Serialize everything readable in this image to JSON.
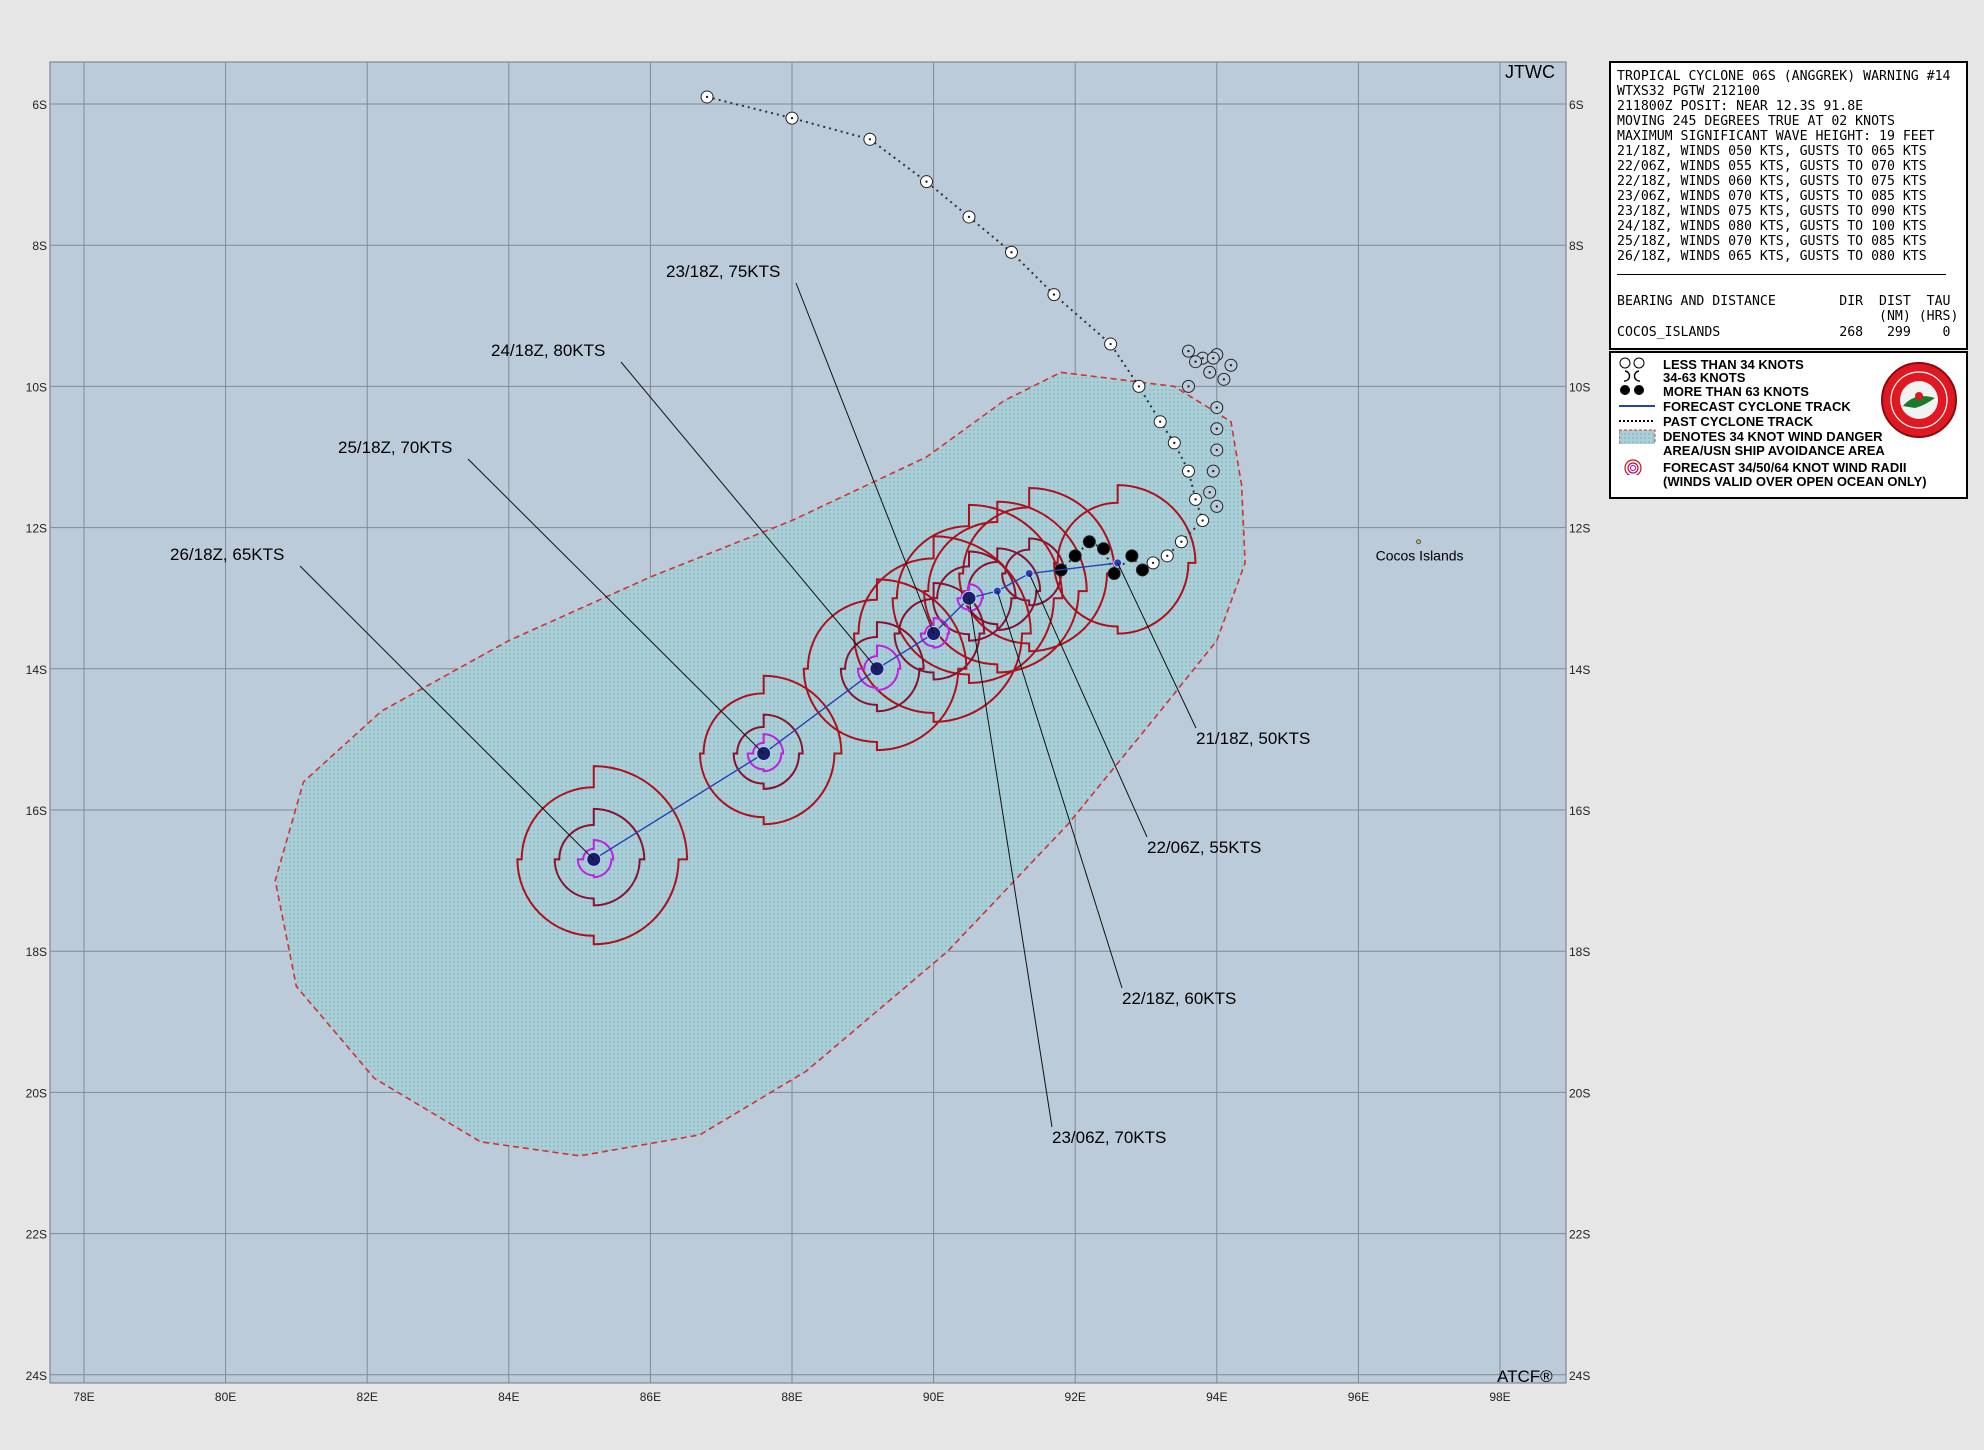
{
  "header": {
    "agency": "JTWC",
    "footer_mark": "ATCF®"
  },
  "info_panel": {
    "lines": [
      "TROPICAL CYCLONE 06S (ANGGREK) WARNING #14",
      "WTXS32 PGTW 212100",
      "211800Z POSIT: NEAR 12.3S 91.8E",
      "MOVING 245 DEGREES TRUE AT 02 KNOTS",
      "MAXIMUM SIGNIFICANT WAVE HEIGHT: 19 FEET",
      "21/18Z, WINDS 050 KTS, GUSTS TO 065 KTS",
      "22/06Z, WINDS 055 KTS, GUSTS TO 070 KTS",
      "22/18Z, WINDS 060 KTS, GUSTS TO 075 KTS",
      "23/06Z, WINDS 070 KTS, GUSTS TO 085 KTS",
      "23/18Z, WINDS 075 KTS, GUSTS TO 090 KTS",
      "24/18Z, WINDS 080 KTS, GUSTS TO 100 KTS",
      "25/18Z, WINDS 070 KTS, GUSTS TO 085 KTS",
      "26/18Z, WINDS 065 KTS, GUSTS TO 080 KTS"
    ],
    "bearing_header": "BEARING AND DISTANCE        DIR  DIST  TAU",
    "bearing_units": "                                 (NM) (HRS)",
    "bearing_row": "COCOS_ISLANDS               268   299    0"
  },
  "legend": {
    "items": [
      {
        "icon": "open-circle-icon",
        "label": "LESS THAN 34 KNOTS"
      },
      {
        "icon": "tropical-storm-icon",
        "label": "34-63 KNOTS"
      },
      {
        "icon": "hurricane-icon",
        "label": "MORE THAN 63 KNOTS"
      },
      {
        "icon": "forecast-track-icon",
        "label": "FORECAST CYCLONE TRACK"
      },
      {
        "icon": "past-track-icon",
        "label": "PAST CYCLONE TRACK"
      },
      {
        "icon": "danger-area-icon",
        "label": "DENOTES 34 KNOT WIND DANGER"
      },
      {
        "icon": "",
        "label": "AREA/USN SHIP AVOIDANCE AREA"
      },
      {
        "icon": "wind-radii-icon",
        "label": "FORECAST 34/50/64 KNOT WIND RADII"
      },
      {
        "icon": "",
        "label": "(WINDS VALID OVER OPEN OCEAN ONLY)"
      }
    ]
  },
  "map": {
    "lon_ticks": [
      "78E",
      "80E",
      "82E",
      "84E",
      "86E",
      "88E",
      "90E",
      "92E",
      "94E",
      "96E",
      "98E"
    ],
    "lat_ticks": [
      "6S",
      "8S",
      "10S",
      "12S",
      "14S",
      "16S",
      "18S",
      "20S",
      "22S",
      "24S"
    ],
    "place": {
      "name": "Cocos Islands",
      "lat": -12.2,
      "lon": 96.85
    },
    "colors": {
      "ocean": "#bccbda",
      "danger_fill": "#a9d0d8",
      "danger_edge": "#d23232",
      "radii_34": "#b0101c",
      "radii_50": "#8c1030",
      "radii_64": "#c020e0",
      "track": "#2a3fb3",
      "grid": "#808a94"
    },
    "forecast_points": [
      {
        "label": "21/18Z, 50KTS",
        "lat": -12.5,
        "lon": 92.6,
        "r34": 1.0,
        "r50": 0.0,
        "r64": 0.0
      },
      {
        "label": "22/06Z, 55KTS",
        "lat": -12.65,
        "lon": 91.35,
        "r34": 1.1,
        "r50": 0.45,
        "r64": 0.0
      },
      {
        "label": "22/18Z, 60KTS",
        "lat": -12.9,
        "lon": 90.9,
        "r34": 1.15,
        "r50": 0.55,
        "r64": 0.0
      },
      {
        "label": "23/06Z, 70KTS",
        "lat": -13.0,
        "lon": 90.5,
        "r34": 1.2,
        "r50": 0.6,
        "r64": 0.18
      },
      {
        "label": "23/18Z, 75KTS",
        "lat": -13.5,
        "lon": 90.0,
        "r34": 1.25,
        "r50": 0.65,
        "r64": 0.2
      },
      {
        "label": "24/18Z, 80KTS",
        "lat": -14.0,
        "lon": 89.2,
        "r34": 1.15,
        "r50": 0.6,
        "r64": 0.3
      },
      {
        "label": "25/18Z, 70KTS",
        "lat": -15.2,
        "lon": 87.6,
        "r34": 1.0,
        "r50": 0.5,
        "r64": 0.25
      },
      {
        "label": "26/18Z, 65KTS",
        "lat": -16.7,
        "lon": 85.2,
        "r34": 1.2,
        "r50": 0.65,
        "r64": 0.25
      }
    ],
    "past_track": [
      {
        "lat": -5.9,
        "lon": 86.8
      },
      {
        "lat": -6.2,
        "lon": 88.0
      },
      {
        "lat": -6.5,
        "lon": 89.1
      },
      {
        "lat": -7.1,
        "lon": 89.9
      },
      {
        "lat": -7.6,
        "lon": 90.5
      },
      {
        "lat": -8.1,
        "lon": 91.1
      },
      {
        "lat": -8.7,
        "lon": 91.7
      },
      {
        "lat": -9.4,
        "lon": 92.5
      },
      {
        "lat": -10.0,
        "lon": 92.9
      },
      {
        "lat": -10.5,
        "lon": 93.2
      },
      {
        "lat": -10.8,
        "lon": 93.4
      },
      {
        "lat": -11.2,
        "lon": 93.6
      },
      {
        "lat": -11.6,
        "lon": 93.7
      },
      {
        "lat": -11.9,
        "lon": 93.8
      },
      {
        "lat": -12.2,
        "lon": 93.5
      },
      {
        "lat": -12.4,
        "lon": 93.3
      },
      {
        "lat": -12.5,
        "lon": 93.1
      },
      {
        "lat": -12.6,
        "lon": 92.95
      },
      {
        "lat": -12.4,
        "lon": 92.8
      },
      {
        "lat": -12.65,
        "lon": 92.55
      },
      {
        "lat": -12.3,
        "lon": 92.4
      },
      {
        "lat": -12.2,
        "lon": 92.2
      },
      {
        "lat": -12.4,
        "lon": 92.0
      },
      {
        "lat": -12.6,
        "lon": 91.8
      }
    ],
    "loop_points": [
      {
        "lat": -9.5,
        "lon": 93.6
      },
      {
        "lat": -9.6,
        "lon": 93.8
      },
      {
        "lat": -9.55,
        "lon": 94.0
      },
      {
        "lat": -9.7,
        "lon": 94.2
      },
      {
        "lat": -9.8,
        "lon": 93.9
      },
      {
        "lat": -9.65,
        "lon": 93.7
      },
      {
        "lat": -10.0,
        "lon": 93.6
      },
      {
        "lat": -10.3,
        "lon": 94.0
      },
      {
        "lat": -10.6,
        "lon": 94.0
      },
      {
        "lat": -10.9,
        "lon": 94.0
      },
      {
        "lat": -11.2,
        "lon": 93.95
      },
      {
        "lat": -11.5,
        "lon": 93.9
      },
      {
        "lat": -11.7,
        "lon": 94.0
      },
      {
        "lat": -9.9,
        "lon": 94.1
      },
      {
        "lat": -9.6,
        "lon": 93.95
      }
    ],
    "danger_area": [
      {
        "lat": -9.8,
        "lon": 91.8
      },
      {
        "lat": -10.0,
        "lon": 93.4
      },
      {
        "lat": -10.5,
        "lon": 94.2
      },
      {
        "lat": -11.4,
        "lon": 94.35
      },
      {
        "lat": -12.5,
        "lon": 94.4
      },
      {
        "lat": -13.6,
        "lon": 94.0
      },
      {
        "lat": -14.6,
        "lon": 93.2
      },
      {
        "lat": -16.2,
        "lon": 91.9
      },
      {
        "lat": -18.0,
        "lon": 90.2
      },
      {
        "lat": -19.7,
        "lon": 88.2
      },
      {
        "lat": -20.6,
        "lon": 86.7
      },
      {
        "lat": -20.9,
        "lon": 85.0
      },
      {
        "lat": -20.7,
        "lon": 83.6
      },
      {
        "lat": -19.8,
        "lon": 82.1
      },
      {
        "lat": -18.5,
        "lon": 81.0
      },
      {
        "lat": -17.0,
        "lon": 80.7
      },
      {
        "lat": -15.6,
        "lon": 81.1
      },
      {
        "lat": -14.6,
        "lon": 82.2
      },
      {
        "lat": -13.6,
        "lon": 84.0
      },
      {
        "lat": -12.7,
        "lon": 86.0
      },
      {
        "lat": -11.9,
        "lon": 88.0
      },
      {
        "lat": -11.0,
        "lon": 89.9
      },
      {
        "lat": -10.2,
        "lon": 91.0
      }
    ]
  }
}
